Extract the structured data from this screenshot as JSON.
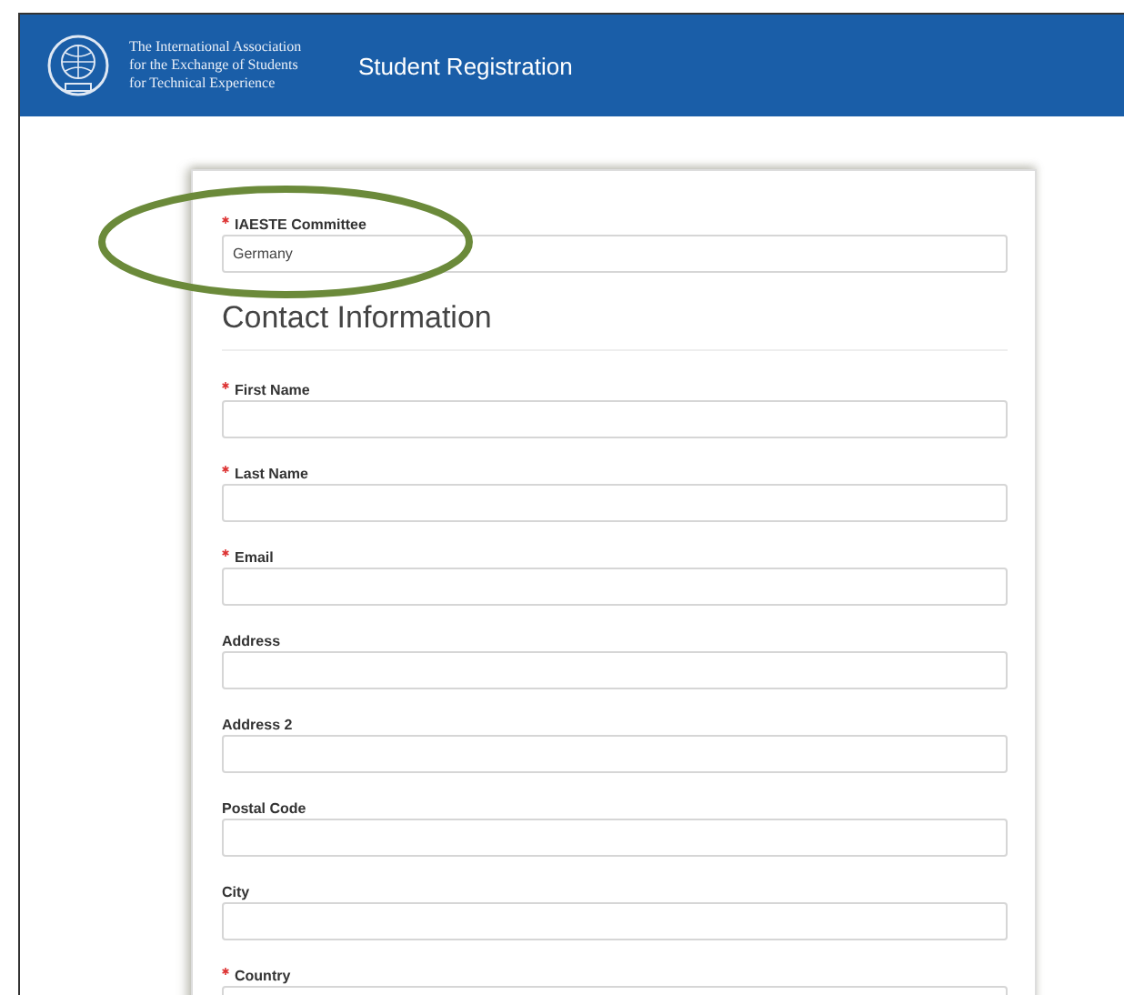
{
  "header": {
    "org_lines": [
      "The International Association",
      "for the Exchange of Students",
      "for Technical Experience"
    ],
    "title": "Student Registration"
  },
  "committee": {
    "label": "IAESTE Committee",
    "required": true,
    "value": "Germany"
  },
  "section_title": "Contact Information",
  "fields": [
    {
      "label": "First Name",
      "required": true
    },
    {
      "label": "Last Name",
      "required": true
    },
    {
      "label": "Email",
      "required": true
    },
    {
      "label": "Address",
      "required": false
    },
    {
      "label": "Address 2",
      "required": false
    },
    {
      "label": "Postal Code",
      "required": false
    },
    {
      "label": "City",
      "required": false
    },
    {
      "label": "Country",
      "required": true
    }
  ]
}
